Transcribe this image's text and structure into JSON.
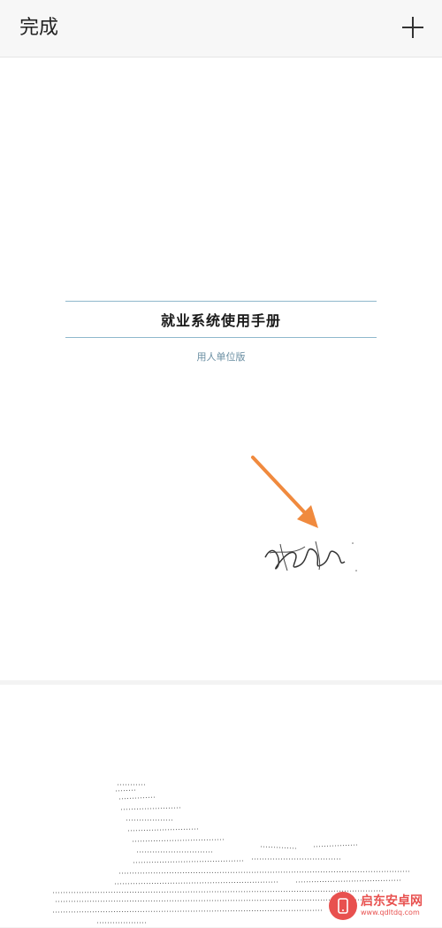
{
  "topbar": {
    "done_label": "完成",
    "add_icon": "plus-icon"
  },
  "document": {
    "title": "就业系统使用手册",
    "subtitle": "用人单位版"
  },
  "annotation": {
    "arrow_icon": "arrow-icon",
    "arrow_color": "#f08a3e"
  },
  "watermark": {
    "name": "启东安卓网",
    "url": "www.qdltdq.com",
    "color": "#e8514f"
  }
}
